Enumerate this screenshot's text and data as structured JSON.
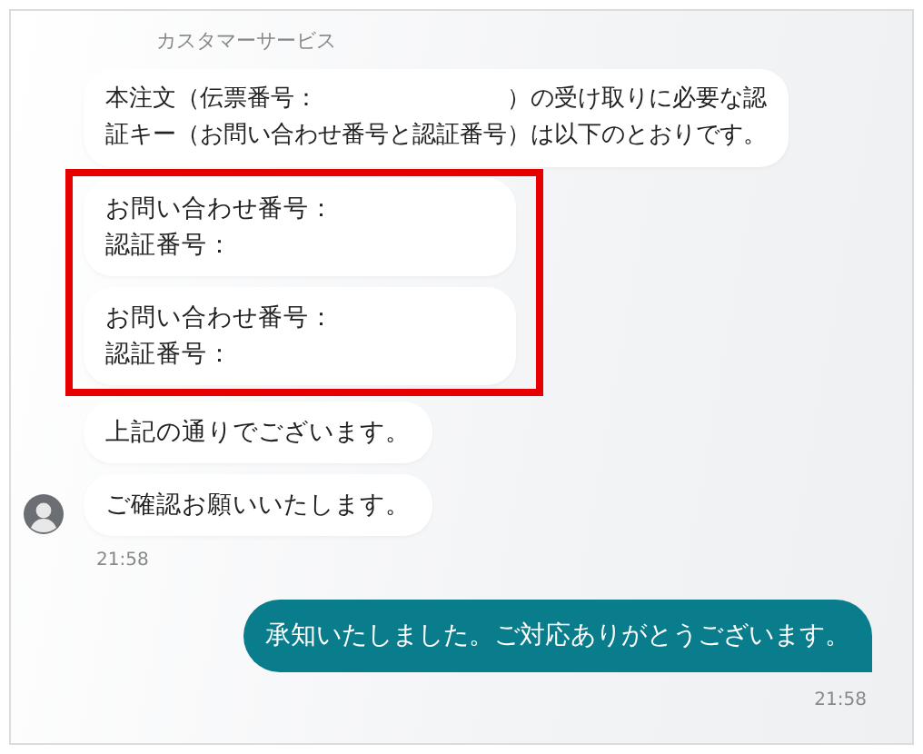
{
  "incoming": {
    "sender": "カスタマーサービス",
    "messages": [
      {
        "text": "本注文（伝票番号：　　　　　　　　）の受け取りに必要な認証キー（お問い合わせ番号と認証番号）は以下のとおりです。",
        "highlighted": false
      },
      {
        "lines": [
          "お問い合わせ番号：",
          "認証番号："
        ],
        "highlighted": true
      },
      {
        "lines": [
          "お問い合わせ番号：",
          "認証番号："
        ],
        "highlighted": true
      },
      {
        "text": "上記の通りでございます。",
        "highlighted": false
      },
      {
        "text": "ご確認お願いいたします。",
        "highlighted": false
      }
    ],
    "time": "21:58"
  },
  "outgoing": {
    "messages": [
      {
        "text": "承知いたしました。ご対応ありがとうございます。"
      }
    ],
    "time": "21:58"
  }
}
